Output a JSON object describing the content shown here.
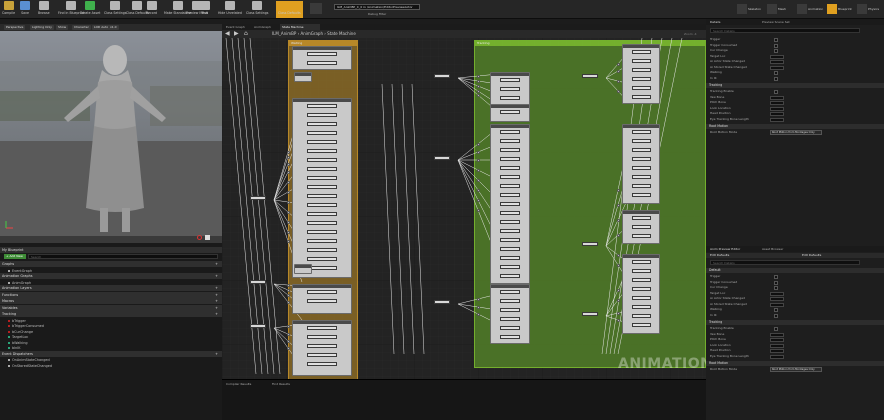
{
  "toolbar": {
    "items": [
      {
        "label": "Compile",
        "color": "#c8a23a"
      },
      {
        "label": "Save",
        "color": "#5a8fd1"
      },
      {
        "label": "Browse",
        "color": "#b5b5b5"
      },
      {
        "label": "Find in Blueprint",
        "color": "#b5b5b5"
      },
      {
        "label": "Create Asset",
        "color": "#3fb04c"
      },
      {
        "label": "Class Settings",
        "color": "#b5b5b5"
      },
      {
        "label": "Class Defaults",
        "color": "#b5b5b5"
      },
      {
        "label": "Record",
        "color": "#b5b5b5"
      },
      {
        "label": "Make Standalone",
        "color": "#b5b5b5"
      },
      {
        "label": "Preview Mesh",
        "color": "#b5b5b5"
      },
      {
        "label": "Find",
        "color": "#b5b5b5"
      },
      {
        "label": "Hide Unrelated",
        "color": "#b5b5b5"
      },
      {
        "label": "Class Settings",
        "color": "#b5b5b5"
      },
      {
        "label": "Class Defaults",
        "color": "#e0a020"
      }
    ],
    "debug_object": "ILM_AnimBP_C_0 in /Animation/EditorPreviewActor",
    "debug_filter": "Debug Filter",
    "modes": [
      "Skeleton",
      "Mesh",
      "Animation",
      "Blueprint",
      "Physics"
    ]
  },
  "viewport": {
    "buttons": [
      "Perspective",
      "Lighting Only",
      "Show",
      "Character",
      "LOD Auto",
      "x1.0"
    ],
    "info": [
      "Previewing ILM_AnimBP",
      "Mesh: SK_Mannequin_Female"
    ]
  },
  "my_blueprint": {
    "title": "My Blueprint",
    "add_new": "+ Add New",
    "search": "Search",
    "sections": [
      {
        "label": "Graphs",
        "items": [
          "EventGraph"
        ]
      },
      {
        "label": "Animation Graphs",
        "items": [
          "AnimGraph"
        ]
      },
      {
        "label": "Animation Layers",
        "items": []
      },
      {
        "label": "Functions",
        "items": []
      },
      {
        "label": "Macros",
        "items": []
      },
      {
        "label": "Variables",
        "items": []
      },
      {
        "label": "Tracking",
        "items": [
          "bTrigger",
          "bTriggerConsumed",
          "bCurChange",
          "TargetLoc",
          "bWalking",
          "bInIK"
        ]
      },
      {
        "label": "Event Dispatchers",
        "items": [
          "OnAnimStateChanged",
          "OnStoredStateChanged"
        ]
      }
    ]
  },
  "graph": {
    "tabs": [
      "Event Graph",
      "AnimGraph",
      "State Machine"
    ],
    "breadcrumb": [
      "ILM_AnimBP",
      "AnimGraph",
      "State Machine"
    ],
    "zoom": "Zoom -4",
    "watermark": "ANIMATION",
    "yellow_box": {
      "title": "Waiting",
      "header_color": "#d29a2a",
      "fill": "#8a6a26"
    },
    "green_box": {
      "title": "Tracking",
      "header_color": "#7dbf2f",
      "fill": "#4f7a28"
    }
  },
  "compiler": {
    "tabs": [
      "Compiler Results",
      "Find Results"
    ]
  },
  "details": {
    "tabs": [
      "Details",
      "Preview Scene Set"
    ],
    "search": "Search Details",
    "default_rows": [
      "Trigger",
      "Trigger Consumed",
      "Cur Change",
      "Target Loc",
      "Ai Actor State Changed",
      "Ai Stored State Changed",
      "Walking",
      "In IK"
    ],
    "tracking_label": "Tracking",
    "tracking_rows": [
      "Tracking Enable",
      "Yaw Bone",
      "Pitch Bone",
      "Look Location",
      "Head Position",
      "Eye Tracking Bone Length"
    ],
    "root_motion_label": "Root Motion",
    "root_motion_row": "Root Motion Mode",
    "root_motion_value": "Root Motion from Montages Only"
  },
  "details2": {
    "tabs": [
      "Anim Preview Editor",
      "Asset Browser"
    ],
    "edit_row": [
      "Edit Defaults",
      "Edit Defaults"
    ],
    "search": "Search Details",
    "default_label": "Default",
    "default_rows": [
      "Trigger",
      "Trigger Consumed",
      "Cur Change",
      "Target Loc",
      "Ai Actor State Changed",
      "Ai Stored State Changed",
      "Walking",
      "In IK"
    ],
    "tracking_label": "Tracking",
    "tracking_rows": [
      "Tracking Enable",
      "Yaw Bone",
      "Pitch Bone",
      "Look Location",
      "Head Position",
      "Eye Tracking Bone Length"
    ],
    "root_motion_label": "Root Motion",
    "root_motion_row": "Root Motion Mode",
    "root_motion_value": "Root Motion from Montages Only"
  }
}
